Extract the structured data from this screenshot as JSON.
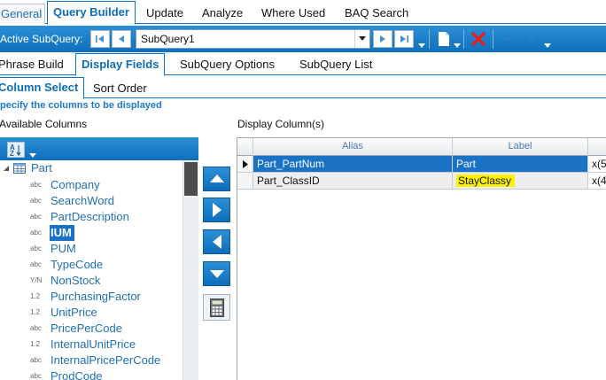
{
  "top_tabs": {
    "general": "General",
    "query_builder": "Query Builder",
    "update": "Update",
    "analyze": "Analyze",
    "where_used": "Where Used",
    "baq_search": "BAQ Search"
  },
  "subquery_bar": {
    "label": "Active SubQuery:",
    "selected_subquery": "SubQuery1"
  },
  "sub_tabs": {
    "phrase_build": "Phrase Build",
    "display_fields": "Display Fields",
    "subquery_options": "SubQuery Options",
    "subquery_list": "SubQuery List"
  },
  "display_tabs": {
    "column_select": "Column Select",
    "sort_order": "Sort Order"
  },
  "hint": "pecify the columns to be displayed",
  "available_columns": {
    "label": "Available Columns",
    "table_name": "Part",
    "fields": [
      {
        "type": "abc",
        "name": "Company"
      },
      {
        "type": "abc",
        "name": "SearchWord"
      },
      {
        "type": "abc",
        "name": "PartDescription"
      },
      {
        "type": "abc",
        "name": "IUM"
      },
      {
        "type": "abc",
        "name": "PUM"
      },
      {
        "type": "abc",
        "name": "TypeCode"
      },
      {
        "type": "Y/N",
        "name": "NonStock"
      },
      {
        "type": "1.2",
        "name": "PurchasingFactor"
      },
      {
        "type": "1.2",
        "name": "UnitPrice"
      },
      {
        "type": "abc",
        "name": "PricePerCode"
      },
      {
        "type": "1.2",
        "name": "InternalUnitPrice"
      },
      {
        "type": "abc",
        "name": "InternalPricePerCode"
      },
      {
        "type": "abc",
        "name": "ProdCode"
      }
    ],
    "selected_field": "IUM"
  },
  "display_columns": {
    "label": "Display Column(s)",
    "headers": {
      "alias": "Alias",
      "label": "Label"
    },
    "rows": [
      {
        "alias": "Part_PartNum",
        "label": "Part",
        "format": "x(5"
      },
      {
        "alias": "Part_ClassID",
        "label": "StayClassy",
        "format": "x(4"
      }
    ]
  },
  "colors": {
    "accent": "#0f6fbb",
    "selection": "#1a72c4",
    "highlight": "#fff200",
    "delete": "#e0201b"
  }
}
